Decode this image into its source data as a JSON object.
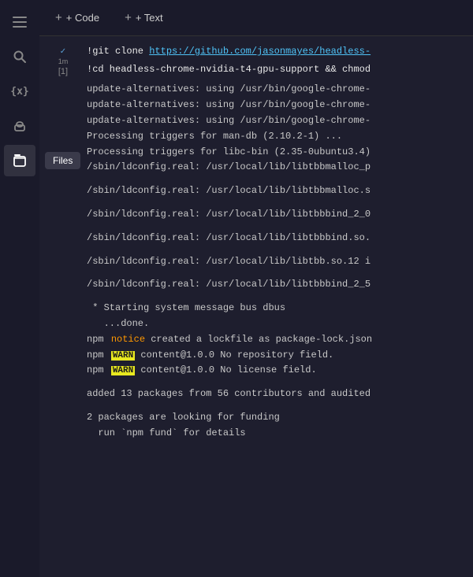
{
  "toolbar": {
    "code_btn": "+ Code",
    "text_btn": "+ Text"
  },
  "sidebar": {
    "icons": [
      {
        "id": "menu-icon",
        "symbol": "☰",
        "active": false,
        "tooltip": null
      },
      {
        "id": "search-icon",
        "symbol": "🔍",
        "active": false,
        "tooltip": null
      },
      {
        "id": "braces-icon",
        "symbol": "{x}",
        "active": false,
        "tooltip": null
      },
      {
        "id": "key-icon",
        "symbol": "🔑",
        "active": false,
        "tooltip": null
      },
      {
        "id": "files-icon",
        "symbol": "📁",
        "active": true,
        "tooltip": "Files"
      }
    ]
  },
  "cell": {
    "run_indicator": "✓",
    "run_time": "1m",
    "number": "[1]",
    "code_lines": [
      "!git clone https://github.com/jasonmayes/headless-",
      "!cd headless-chrome-nvidia-t4-gpu-support && chmod"
    ]
  },
  "output": {
    "lines": [
      {
        "type": "normal",
        "text": "update-alternatives: using /usr/bin/google-chrome-"
      },
      {
        "type": "normal",
        "text": "update-alternatives: using /usr/bin/google-chrome-"
      },
      {
        "type": "normal",
        "text": "update-alternatives: using /usr/bin/google-chrome-"
      },
      {
        "type": "normal",
        "text": "Processing triggers for man-db (2.10.2-1) ..."
      },
      {
        "type": "normal",
        "text": "Processing triggers for libc-bin (2.35-0ubuntu3.4)"
      },
      {
        "type": "normal",
        "text": "/sbin/ldconfig.real: /usr/local/lib/libtbbmalloc_p"
      },
      {
        "type": "empty"
      },
      {
        "type": "normal",
        "text": "/sbin/ldconfig.real: /usr/local/lib/libtbbmalloc.s"
      },
      {
        "type": "empty"
      },
      {
        "type": "normal",
        "text": "/sbin/ldconfig.real: /usr/local/lib/libtbbbind_2_0"
      },
      {
        "type": "empty"
      },
      {
        "type": "normal",
        "text": "/sbin/ldconfig.real: /usr/local/lib/libtbbbind.so."
      },
      {
        "type": "empty"
      },
      {
        "type": "normal",
        "text": "/sbin/ldconfig.real: /usr/local/lib/libtbb.so.12 i"
      },
      {
        "type": "empty"
      },
      {
        "type": "normal",
        "text": "/sbin/ldconfig.real: /usr/local/lib/libtbbbind_2_5"
      },
      {
        "type": "empty"
      },
      {
        "type": "system",
        "text": " * Starting system message bus dbus"
      },
      {
        "type": "system",
        "text": "   ...done."
      },
      {
        "type": "npm-notice",
        "prefix": "npm",
        "badge": "notice",
        "badge_type": "notice",
        "text": " created a lockfile as package-lock.json"
      },
      {
        "type": "npm-warn",
        "prefix": "npm",
        "badge": "WARN",
        "badge_type": "warn",
        "text": " content@1.0.0 No repository field."
      },
      {
        "type": "npm-warn",
        "prefix": "npm",
        "badge": "WARN",
        "badge_type": "warn",
        "text": " content@1.0.0 No license field."
      },
      {
        "type": "empty"
      },
      {
        "type": "normal",
        "text": "added 13 packages from 56 contributors and audited"
      },
      {
        "type": "empty"
      },
      {
        "type": "normal",
        "text": "2 packages are looking for funding"
      },
      {
        "type": "normal",
        "text": "  run `npm fund` for details"
      }
    ]
  }
}
